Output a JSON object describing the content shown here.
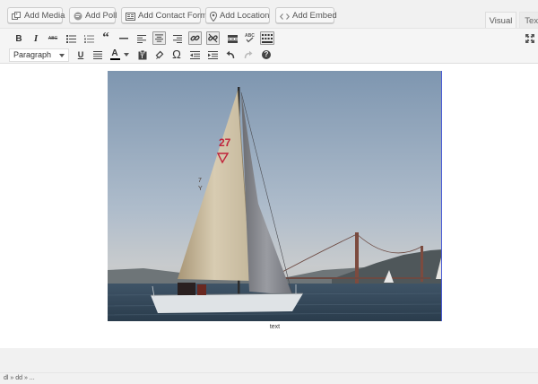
{
  "media_buttons": {
    "add_media": "Add Media",
    "add_poll": "Add Poll",
    "add_contact_form": "Add Contact Form",
    "add_location": "Add Location",
    "add_embed": "Add Embed"
  },
  "tabs": {
    "visual": "Visual",
    "text": "Text"
  },
  "toolbar": {
    "format_select_value": "Paragraph",
    "bold_glyph": "B",
    "italic_glyph": "I",
    "strike_glyph": "ABC",
    "blockquote_glyph": "“",
    "underline_glyph": "U",
    "text_color_glyph": "A",
    "special_char_glyph": "Ω",
    "help_glyph": "?"
  },
  "content": {
    "caption": "text",
    "status_path": "dl » dd » ..."
  },
  "colors": {
    "accent_border": "#4a5bd6",
    "toolbar_bg": "#f5f5f5"
  }
}
